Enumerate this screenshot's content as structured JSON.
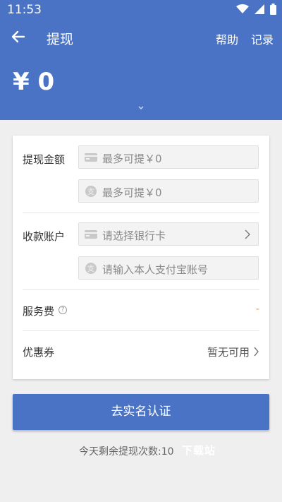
{
  "status_bar": {
    "time": "11:53",
    "icons": [
      "wifi-icon",
      "signal-icon",
      "battery-icon"
    ]
  },
  "header": {
    "title": "提现",
    "help_label": "帮助",
    "records_label": "记录",
    "balance": "¥ 0",
    "accent_color": "#4a73c6"
  },
  "amount": {
    "label": "提现金额",
    "bank_max": "最多可提￥0",
    "alipay_max": "最多可提￥0"
  },
  "account": {
    "label": "收款账户",
    "bank_placeholder": "请选择银行卡",
    "alipay_placeholder": "请输入本人支付宝账号"
  },
  "fee": {
    "label": "服务费",
    "help_glyph": "?",
    "value": "-"
  },
  "coupon": {
    "label": "优惠券",
    "value": "暂无可用"
  },
  "cta_label": "去实名认证",
  "note": "今天剩余提现次数:10",
  "watermark": "下载站"
}
